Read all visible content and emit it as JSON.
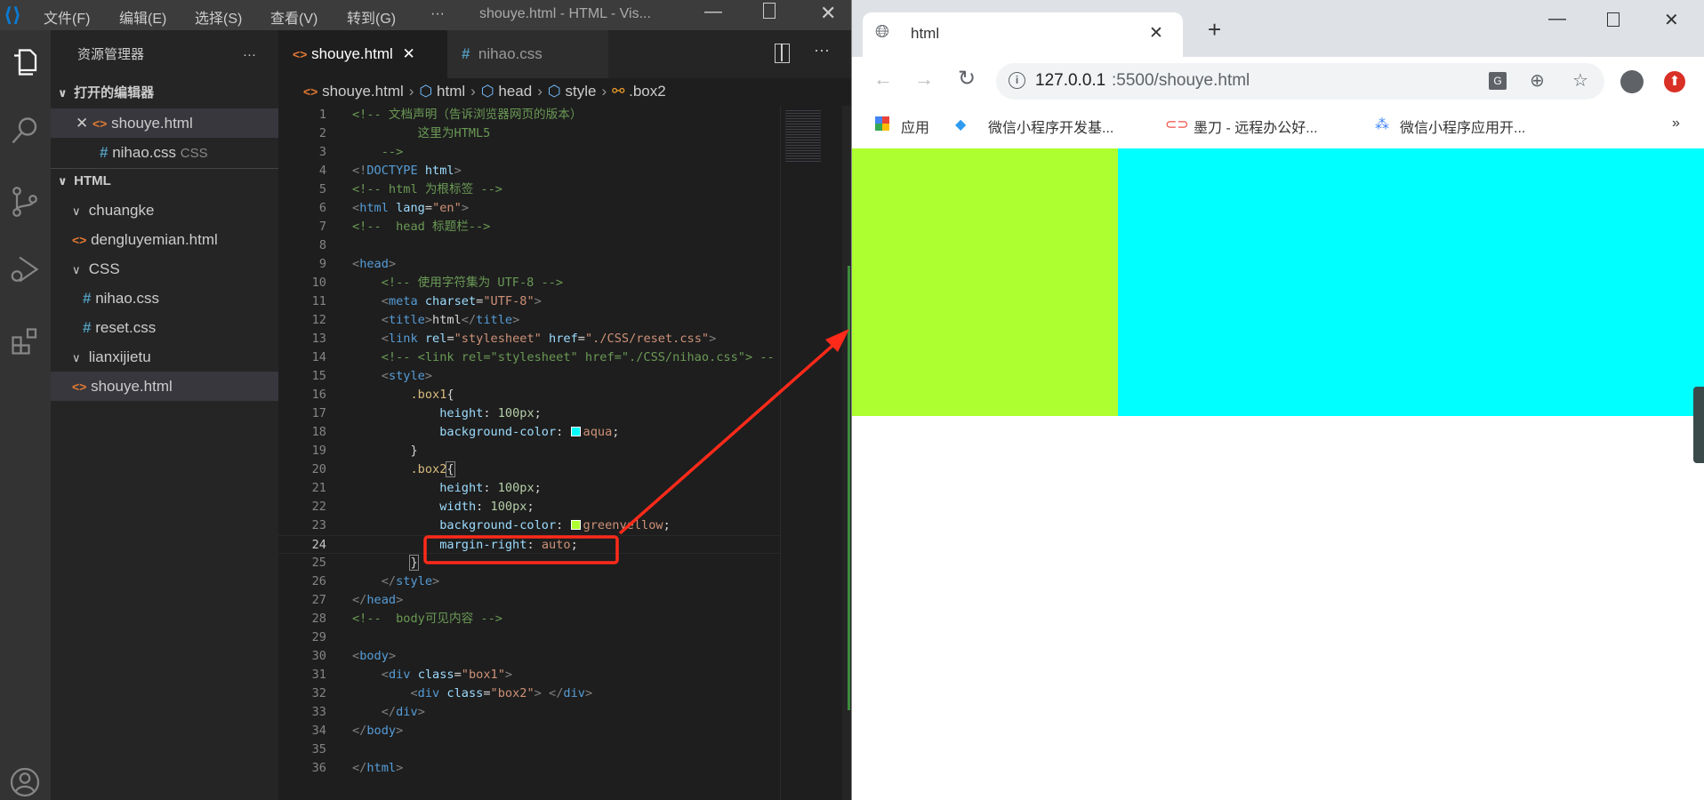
{
  "vscode": {
    "menu": [
      "文件(F)",
      "编辑(E)",
      "选择(S)",
      "查看(V)",
      "转到(G)",
      "···"
    ],
    "window_title": "shouye.html - HTML - Vis...",
    "sidebar": {
      "title": "资源管理器",
      "more": "···",
      "open_editors_label": "打开的编辑器",
      "open_editors": [
        {
          "name": "shouye.html",
          "icon": "html-file-icon"
        },
        {
          "name": "nihao.css",
          "hint": "CSS",
          "icon": "css-file-icon"
        }
      ],
      "workspace_label": "HTML",
      "tree": [
        {
          "name": "chuangke",
          "type": "folder"
        },
        {
          "name": "dengluyemian.html",
          "type": "html"
        },
        {
          "name": "CSS",
          "type": "folder"
        },
        {
          "name": "nihao.css",
          "type": "css"
        },
        {
          "name": "reset.css",
          "type": "css"
        },
        {
          "name": "lianxijietu",
          "type": "folder"
        },
        {
          "name": "shouye.html",
          "type": "html"
        }
      ]
    },
    "tabs": [
      {
        "label": "shouye.html",
        "active": true
      },
      {
        "label": "nihao.css",
        "active": false
      }
    ],
    "breadcrumb": [
      "shouye.html",
      "html",
      "head",
      "style",
      ".box2"
    ],
    "code": [
      [
        [
          "c",
          "<!-- 文档声明（告诉浏览器网页的版本）"
        ]
      ],
      [
        [
          "c",
          "         这里为HTML5"
        ]
      ],
      [
        [
          "c",
          "    -->"
        ]
      ],
      [
        [
          "p",
          "<!"
        ],
        [
          "t",
          "DOCTYPE"
        ],
        [
          "x",
          " "
        ],
        [
          "a",
          "html"
        ],
        [
          "p",
          ">"
        ]
      ],
      [
        [
          "c",
          "<!-- html 为根标签 -->"
        ]
      ],
      [
        [
          "p",
          "<"
        ],
        [
          "t",
          "html"
        ],
        [
          "x",
          " "
        ],
        [
          "a",
          "lang"
        ],
        [
          "x",
          "="
        ],
        [
          "s",
          "\"en\""
        ],
        [
          "p",
          ">"
        ]
      ],
      [
        [
          "c",
          "<!--  head 标题栏-->"
        ]
      ],
      [],
      [
        [
          "p",
          "<"
        ],
        [
          "t",
          "head"
        ],
        [
          "p",
          ">"
        ]
      ],
      [
        [
          "x",
          "    "
        ],
        [
          "c",
          "<!-- 使用字符集为 UTF-8 -->"
        ]
      ],
      [
        [
          "x",
          "    "
        ],
        [
          "p",
          "<"
        ],
        [
          "t",
          "meta"
        ],
        [
          "x",
          " "
        ],
        [
          "a",
          "charset"
        ],
        [
          "x",
          "="
        ],
        [
          "s",
          "\"UTF-8\""
        ],
        [
          "p",
          ">"
        ]
      ],
      [
        [
          "x",
          "    "
        ],
        [
          "p",
          "<"
        ],
        [
          "t",
          "title"
        ],
        [
          "p",
          ">"
        ],
        [
          "x",
          "html"
        ],
        [
          "p",
          "</"
        ],
        [
          "t",
          "title"
        ],
        [
          "p",
          ">"
        ]
      ],
      [
        [
          "x",
          "    "
        ],
        [
          "p",
          "<"
        ],
        [
          "t",
          "link"
        ],
        [
          "x",
          " "
        ],
        [
          "a",
          "rel"
        ],
        [
          "x",
          "="
        ],
        [
          "s",
          "\"stylesheet\""
        ],
        [
          "x",
          " "
        ],
        [
          "a",
          "href"
        ],
        [
          "x",
          "="
        ],
        [
          "s",
          "\"./CSS/reset.css\""
        ],
        [
          "p",
          ">"
        ]
      ],
      [
        [
          "x",
          "    "
        ],
        [
          "c",
          "<!-- <link rel=\"stylesheet\" href=\"./CSS/nihao.css\"> --"
        ]
      ],
      [
        [
          "x",
          "    "
        ],
        [
          "p",
          "<"
        ],
        [
          "t",
          "style"
        ],
        [
          "p",
          ">"
        ]
      ],
      [
        [
          "x",
          "        "
        ],
        [
          "sel",
          ".box1"
        ],
        [
          "x",
          "{"
        ]
      ],
      [
        [
          "x",
          "            "
        ],
        [
          "a",
          "height"
        ],
        [
          "x",
          ": "
        ],
        [
          "n",
          "100px"
        ],
        [
          "x",
          ";"
        ]
      ],
      [
        [
          "x",
          "            "
        ],
        [
          "a",
          "background-color"
        ],
        [
          "x",
          ": "
        ],
        [
          "sw",
          "#00ffff"
        ],
        [
          "s",
          "aqua"
        ],
        [
          "x",
          ";"
        ]
      ],
      [
        [
          "x",
          "        }"
        ]
      ],
      [
        [
          "x",
          "        "
        ],
        [
          "sel",
          ".box2"
        ],
        [
          "br",
          "{"
        ]
      ],
      [
        [
          "x",
          "            "
        ],
        [
          "a",
          "height"
        ],
        [
          "x",
          ": "
        ],
        [
          "n",
          "100px"
        ],
        [
          "x",
          ";"
        ]
      ],
      [
        [
          "x",
          "            "
        ],
        [
          "a",
          "width"
        ],
        [
          "x",
          ": "
        ],
        [
          "n",
          "100px"
        ],
        [
          "x",
          ";"
        ]
      ],
      [
        [
          "x",
          "            "
        ],
        [
          "a",
          "background-color"
        ],
        [
          "x",
          ": "
        ],
        [
          "sw",
          "#adff2f"
        ],
        [
          "s",
          "greenyellow"
        ],
        [
          "x",
          ";"
        ]
      ],
      [
        [
          "x",
          "            "
        ],
        [
          "a",
          "margin-right"
        ],
        [
          "x",
          ": "
        ],
        [
          "s",
          "auto"
        ],
        [
          "x",
          ";"
        ]
      ],
      [
        [
          "x",
          "        "
        ],
        [
          "br",
          "}"
        ]
      ],
      [
        [
          "x",
          "    "
        ],
        [
          "p",
          "</"
        ],
        [
          "t",
          "style"
        ],
        [
          "p",
          ">"
        ]
      ],
      [
        [
          "p",
          "</"
        ],
        [
          "t",
          "head"
        ],
        [
          "p",
          ">"
        ]
      ],
      [
        [
          "c",
          "<!--  body可见内容 -->"
        ]
      ],
      [],
      [
        [
          "p",
          "<"
        ],
        [
          "t",
          "body"
        ],
        [
          "p",
          ">"
        ]
      ],
      [
        [
          "x",
          "    "
        ],
        [
          "p",
          "<"
        ],
        [
          "t",
          "div"
        ],
        [
          "x",
          " "
        ],
        [
          "a",
          "class"
        ],
        [
          "x",
          "="
        ],
        [
          "s",
          "\"box1\""
        ],
        [
          "p",
          ">"
        ]
      ],
      [
        [
          "x",
          "        "
        ],
        [
          "p",
          "<"
        ],
        [
          "t",
          "div"
        ],
        [
          "x",
          " "
        ],
        [
          "a",
          "class"
        ],
        [
          "x",
          "="
        ],
        [
          "s",
          "\"box2\""
        ],
        [
          "p",
          "> </"
        ],
        [
          "t",
          "div"
        ],
        [
          "p",
          ">"
        ]
      ],
      [
        [
          "x",
          "    "
        ],
        [
          "p",
          "</"
        ],
        [
          "t",
          "div"
        ],
        [
          "p",
          ">"
        ]
      ],
      [
        [
          "p",
          "</"
        ],
        [
          "t",
          "body"
        ],
        [
          "p",
          ">"
        ]
      ],
      [],
      [
        [
          "p",
          "</"
        ],
        [
          "t",
          "html"
        ],
        [
          "p",
          ">"
        ]
      ]
    ],
    "current_line": 24
  },
  "browser": {
    "tab_title": "html",
    "url_host": "127.0.0.1",
    "url_rest": ":5500/shouye.html",
    "bookmarks": [
      "应用",
      "微信小程序开发基...",
      "墨刀 - 远程办公好...",
      "微信小程序应用开..."
    ],
    "more_bookmarks": "»",
    "page": {
      "box1_color": "#00ffff",
      "box2_color": "#adff2f"
    }
  },
  "annotation_color": "#ff2a1a"
}
